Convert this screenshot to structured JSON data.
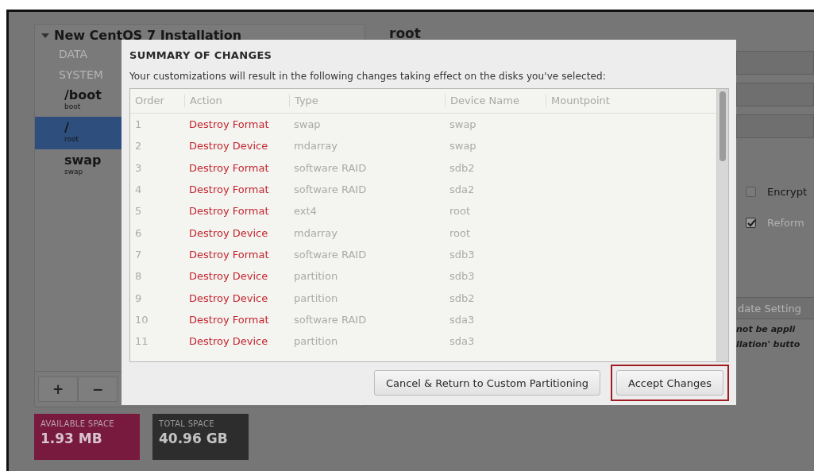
{
  "sidebar": {
    "title": "New CentOS 7 Installation",
    "expanded": true,
    "groups": [
      {
        "label": "DATA"
      },
      {
        "label": "SYSTEM"
      }
    ],
    "items": [
      {
        "mountpoint": "/boot",
        "label": "boot",
        "selected": false
      },
      {
        "mountpoint": "/",
        "label": "root",
        "selected": true
      },
      {
        "mountpoint": "swap",
        "label": "swap",
        "selected": false
      }
    ],
    "toolbar": [
      "+",
      "−"
    ],
    "space": [
      {
        "label": "AVAILABLE SPACE",
        "value": "1.93 MB",
        "kind": "available"
      },
      {
        "label": "TOTAL SPACE",
        "value": "40.96 GB",
        "kind": "total"
      }
    ]
  },
  "details": {
    "heading": "root",
    "checkboxes": [
      {
        "label": "Encrypt",
        "checked": false
      },
      {
        "label": "Reform",
        "checked": true
      }
    ],
    "button": "date Setting",
    "note": [
      "not be appli",
      "llation' butto"
    ]
  },
  "dialog": {
    "title": "SUMMARY OF CHANGES",
    "description": "Your customizations will result in the following changes taking effect on the disks you've selected:",
    "table": {
      "columns": [
        "Order",
        "Action",
        "Type",
        "Device Name",
        "Mountpoint"
      ],
      "rows": [
        {
          "order": "1",
          "action": "Destroy Format",
          "type": "swap",
          "device_name": "swap"
        },
        {
          "order": "2",
          "action": "Destroy Device",
          "type": "mdarray",
          "device_name": "swap"
        },
        {
          "order": "3",
          "action": "Destroy Format",
          "type": "software RAID",
          "device_name": "sdb2"
        },
        {
          "order": "4",
          "action": "Destroy Format",
          "type": "software RAID",
          "device_name": "sda2"
        },
        {
          "order": "5",
          "action": "Destroy Format",
          "type": "ext4",
          "device_name": "root"
        },
        {
          "order": "6",
          "action": "Destroy Device",
          "type": "mdarray",
          "device_name": "root"
        },
        {
          "order": "7",
          "action": "Destroy Format",
          "type": "software RAID",
          "device_name": "sdb3"
        },
        {
          "order": "8",
          "action": "Destroy Device",
          "type": "partition",
          "device_name": "sdb3"
        },
        {
          "order": "9",
          "action": "Destroy Device",
          "type": "partition",
          "device_name": "sdb2"
        },
        {
          "order": "10",
          "action": "Destroy Format",
          "type": "software RAID",
          "device_name": "sda3"
        },
        {
          "order": "11",
          "action": "Destroy Device",
          "type": "partition",
          "device_name": "sda3"
        }
      ]
    },
    "buttons": [
      {
        "label": "Cancel & Return to Custom Partitioning",
        "highlighted": false
      },
      {
        "label": "Accept Changes",
        "highlighted": true
      }
    ]
  }
}
